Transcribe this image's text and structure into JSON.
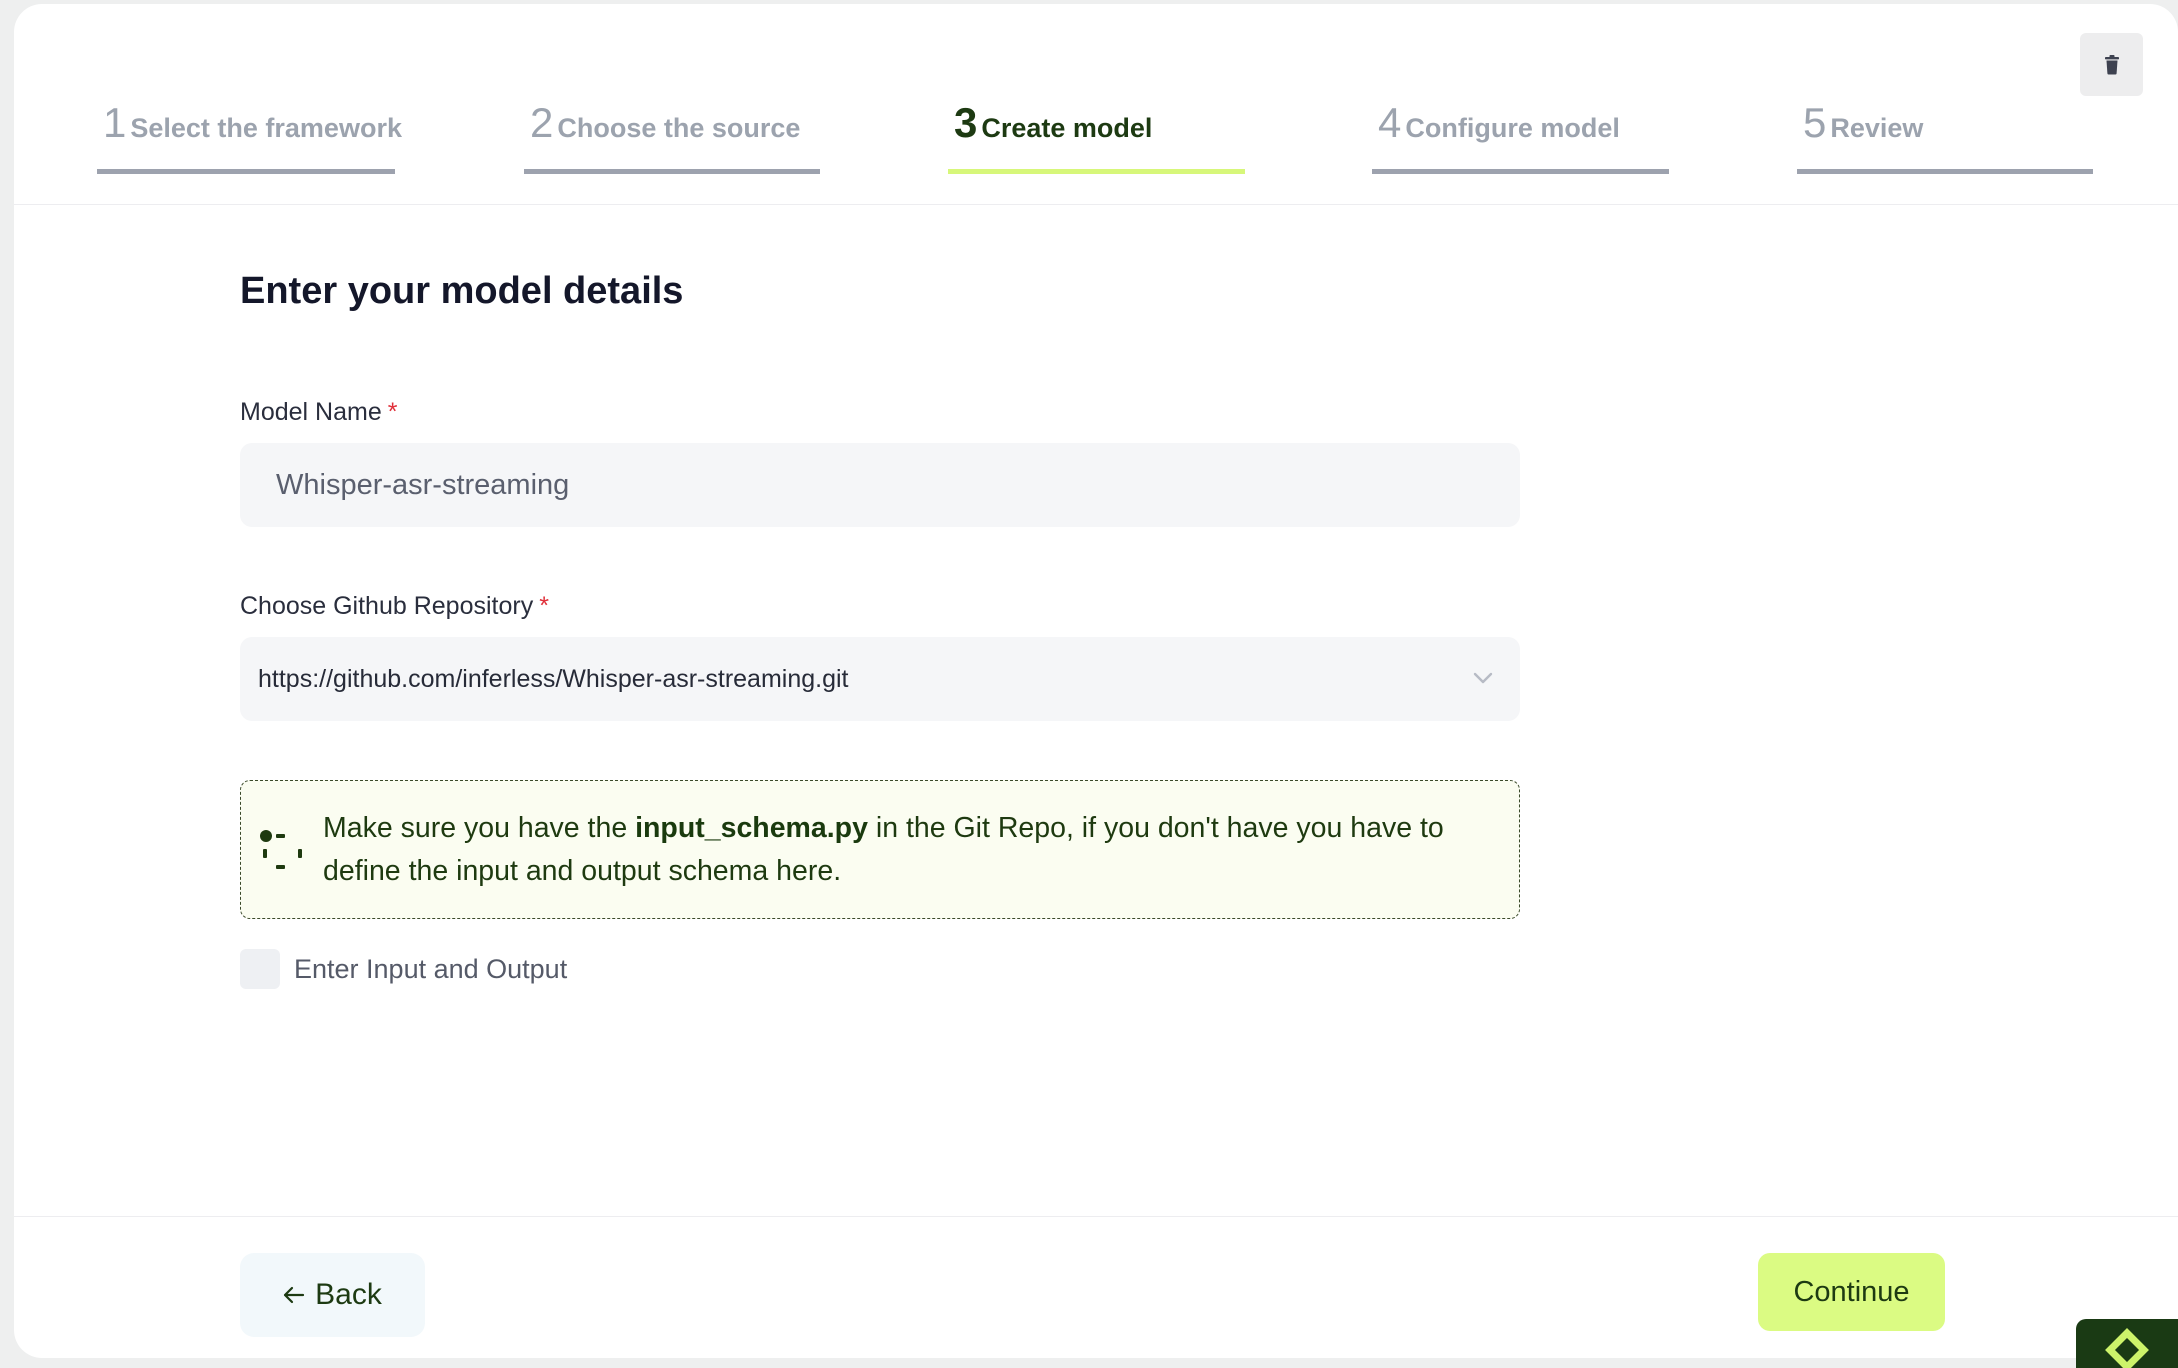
{
  "steps": [
    {
      "num": "1",
      "label": "Select the framework",
      "state": "inactive"
    },
    {
      "num": "2",
      "label": "Choose the source",
      "state": "inactive"
    },
    {
      "num": "3",
      "label": "Create model",
      "state": "active"
    },
    {
      "num": "4",
      "label": "Configure model",
      "state": "inactive"
    },
    {
      "num": "5",
      "label": "Review",
      "state": "inactive"
    }
  ],
  "header": {
    "delete_icon": "trash-icon"
  },
  "form": {
    "title": "Enter your model details",
    "model_name": {
      "label": "Model Name",
      "required_mark": "*",
      "value": "Whisper-asr-streaming"
    },
    "repository": {
      "label": "Choose Github Repository",
      "required_mark": "*",
      "value": "https://github.com/inferless/Whisper-asr-streaming.git",
      "icon": "chevron-down-icon"
    },
    "notice": {
      "text_before": "Make sure you have the ",
      "highlight": "input_schema.py",
      "text_after": " in the Git Repo, if you don't have you have to define the input and output schema here.",
      "icon": "dots-loader-icon"
    },
    "io_checkbox": {
      "label": "Enter Input and Output",
      "checked": false
    }
  },
  "footer": {
    "back_label": "Back",
    "back_icon": "arrow-left-icon",
    "continue_label": "Continue"
  },
  "colors": {
    "accent": "#dbfb83",
    "active_step_underline": "#d7f77a",
    "inactive_step": "#9ca3ae",
    "dark_green": "#1d3a12",
    "required": "#e0303a"
  }
}
